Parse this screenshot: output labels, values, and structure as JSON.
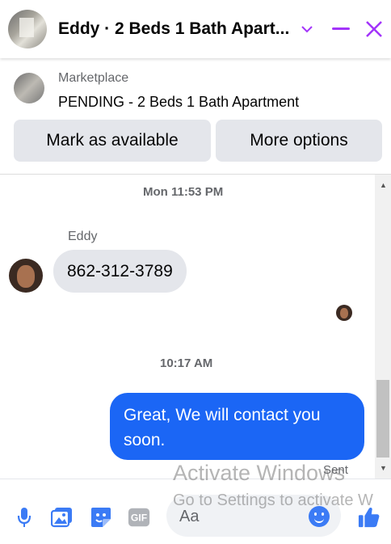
{
  "header": {
    "title": "Eddy · 2 Beds 1 Bath Apart...",
    "icons": [
      "chevron-down-icon",
      "minimize-icon",
      "close-icon"
    ],
    "accent_color": "#a334fa"
  },
  "listing": {
    "label": "Marketplace",
    "status": "PENDING - 2 Beds 1 Bath Apartment",
    "buttons": {
      "mark_available": "Mark as available",
      "more_options": "More options"
    }
  },
  "thread": {
    "messages": [
      {
        "time": "Mon 11:53 PM",
        "sender": "Eddy",
        "text": "862-312-3789",
        "direction": "incoming"
      },
      {
        "time": "10:17 AM",
        "text": "Great, We will contact you soon.",
        "direction": "outgoing",
        "status": "Sent"
      }
    ],
    "outgoing_color": "#1b66f5"
  },
  "composer": {
    "placeholder": "Aa",
    "icons": [
      "microphone-icon",
      "photo-icon",
      "sticker-icon",
      "gif-icon",
      "emoji-icon",
      "thumbs-up-icon"
    ]
  },
  "watermark": {
    "line1": "Activate Windows",
    "line2": "Go to Settings to activate W"
  }
}
